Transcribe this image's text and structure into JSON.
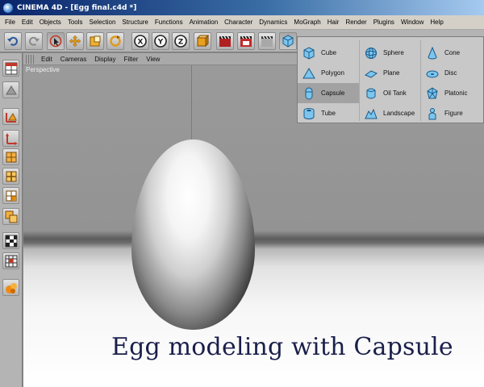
{
  "window": {
    "title": "CINEMA 4D - [Egg final.c4d *]"
  },
  "menubar": {
    "items": [
      "File",
      "Edit",
      "Objects",
      "Tools",
      "Selection",
      "Structure",
      "Functions",
      "Animation",
      "Character",
      "Dynamics",
      "MoGraph",
      "Hair",
      "Render",
      "Plugins",
      "Window",
      "Help"
    ]
  },
  "toolbar": {
    "icons": [
      "undo-icon",
      "redo-icon",
      "live-select-icon",
      "move-icon",
      "scale-icon",
      "rotate-icon",
      "x-axis-lock-icon",
      "y-axis-lock-icon",
      "z-axis-lock-icon",
      "world-coordinates-icon",
      "render-view-icon",
      "render-picture-viewer-icon",
      "render-settings-icon",
      "primitive-object-icon"
    ],
    "x_label": "X",
    "y_label": "Y",
    "z_label": "Z"
  },
  "left_toolbar": {
    "icons": [
      "layout-icon",
      "use-model-tool-icon",
      "object-axis-icon",
      "axis-icon",
      "points-mode-icon",
      "edges-mode-icon",
      "polygons-mode-icon",
      "texture-mode-icon",
      "checkerboard-icon",
      "uvw-icon",
      "hair-icon"
    ]
  },
  "viewport": {
    "menu": [
      "Edit",
      "Cameras",
      "Display",
      "Filter",
      "View"
    ],
    "label": "Perspective",
    "caption": "Egg modeling with Capsule"
  },
  "object_menu": {
    "items": [
      [
        "Cube",
        "Polygon",
        "Capsule",
        "Tube"
      ],
      [
        "Sphere",
        "Plane",
        "Oil Tank",
        "Landscape"
      ],
      [
        "Cone",
        "Disc",
        "Platonic",
        "Figure"
      ]
    ],
    "highlighted": "Capsule"
  },
  "colors": {
    "title_bar": "#0a246a",
    "menu_bg": "#d4d0c8",
    "caption_text": "#1a1f4a",
    "y_axis": "#3fa63f",
    "icon_blue": "#3aa0d8"
  }
}
